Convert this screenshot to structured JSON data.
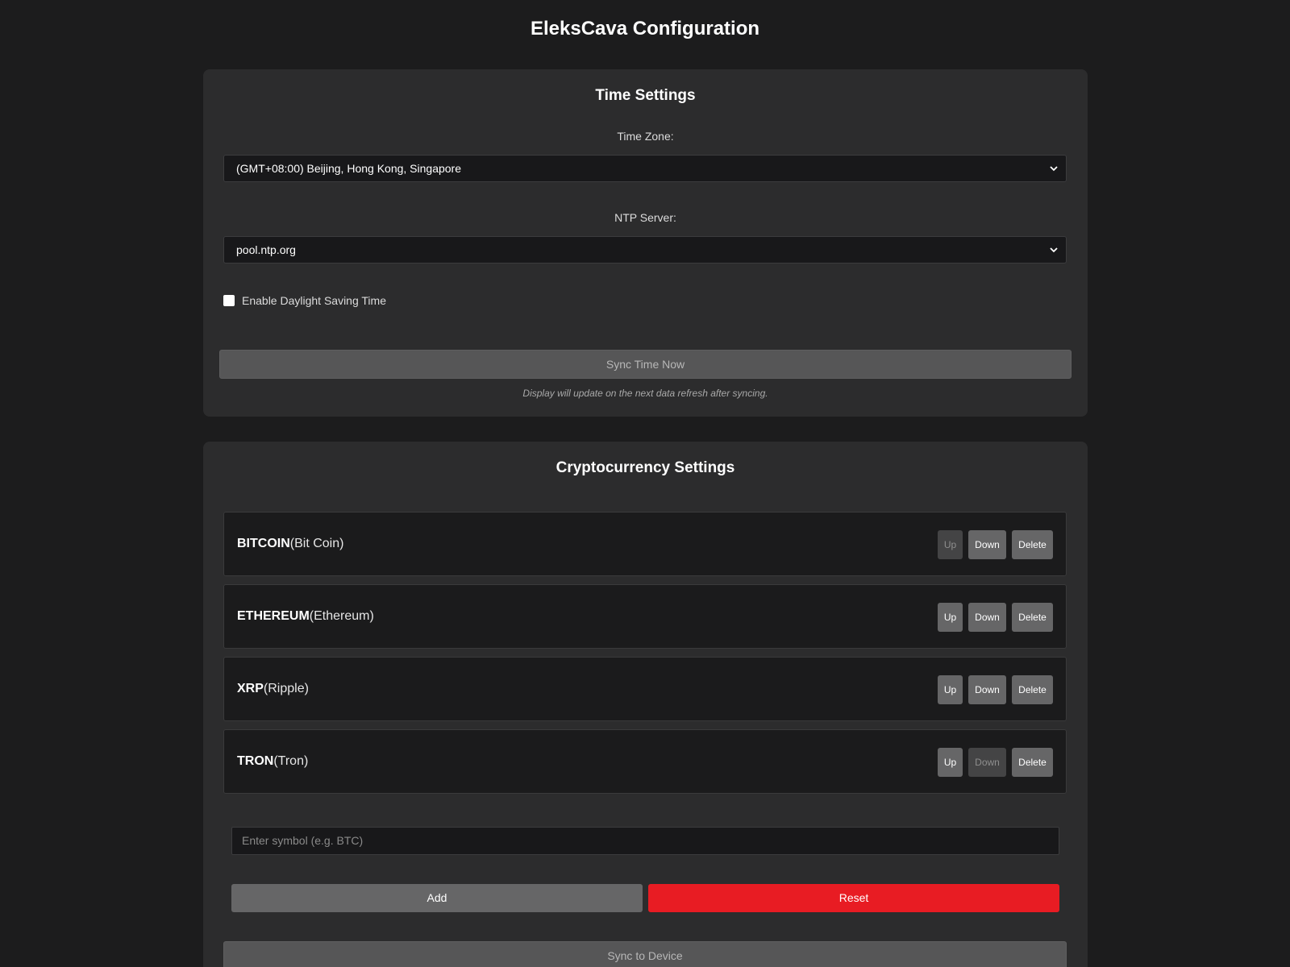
{
  "app": {
    "title": "EleksCava Configuration"
  },
  "time_settings": {
    "title": "Time Settings",
    "timezone_label": "Time Zone:",
    "timezone_value": "(GMT+08:00) Beijing, Hong Kong, Singapore",
    "ntp_label": "NTP Server:",
    "ntp_value": "pool.ntp.org",
    "dst_label": "Enable Daylight Saving Time",
    "dst_checked": false,
    "sync_button": "Sync Time Now",
    "note": "Display will update on the next data refresh after syncing."
  },
  "crypto_settings": {
    "title": "Cryptocurrency Settings",
    "buttons": {
      "up": "Up",
      "down": "Down",
      "delete": "Delete"
    },
    "coins": [
      {
        "symbol": "BITCOIN",
        "name": "(Bit Coin)",
        "up_enabled": false,
        "down_enabled": true
      },
      {
        "symbol": "ETHEREUM",
        "name": "(Ethereum)",
        "up_enabled": true,
        "down_enabled": true
      },
      {
        "symbol": "XRP",
        "name": "(Ripple)",
        "up_enabled": true,
        "down_enabled": true
      },
      {
        "symbol": "TRON",
        "name": "(Tron)",
        "up_enabled": true,
        "down_enabled": false
      }
    ],
    "symbol_placeholder": "Enter symbol (e.g. BTC)",
    "add_button": "Add",
    "reset_button": "Reset",
    "sync_device_button": "Sync to Device"
  },
  "colors": {
    "background": "#1c1c1d",
    "card": "#2c2c2d",
    "reset": "#e81c23"
  }
}
